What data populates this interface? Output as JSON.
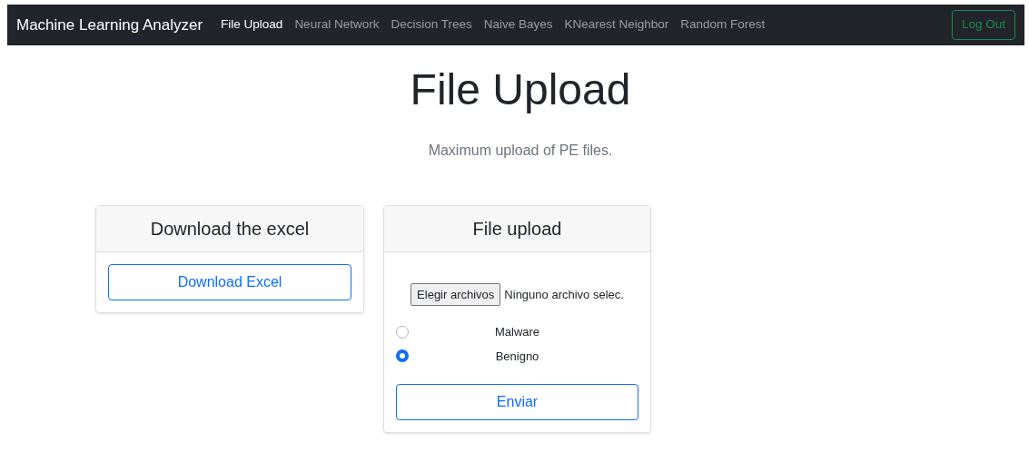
{
  "navbar": {
    "brand": "Machine Learning Analyzer",
    "links": [
      {
        "label": "File Upload",
        "selected": true
      },
      {
        "label": "Neural Network",
        "selected": false
      },
      {
        "label": "Decision Trees",
        "selected": false
      },
      {
        "label": "Naive Bayes",
        "selected": false
      },
      {
        "label": "KNearest Neighbor",
        "selected": false
      },
      {
        "label": "Random Forest",
        "selected": false
      }
    ],
    "logout": "Log Out"
  },
  "heading": "File Upload",
  "subtitle": "Maximum upload of PE files.",
  "download_card": {
    "title": "Download the excel",
    "button": "Download Excel"
  },
  "upload_card": {
    "title": "File upload",
    "file_button": "Elegir archivos",
    "file_status": "Ninguno archivo selec.",
    "options": [
      {
        "label": "Malware",
        "selected": false
      },
      {
        "label": "Benigno",
        "selected": true
      }
    ],
    "submit": "Enviar"
  }
}
